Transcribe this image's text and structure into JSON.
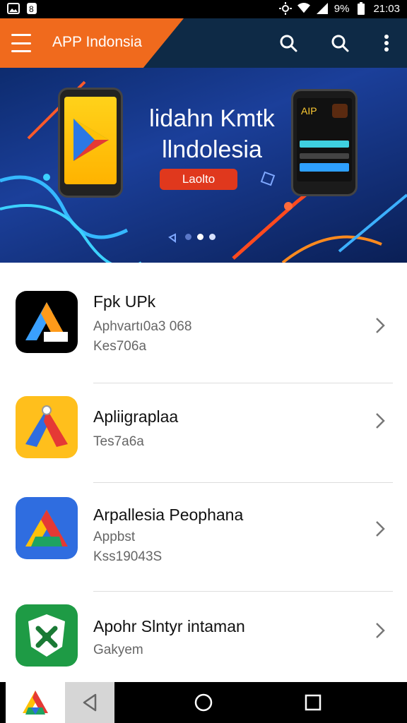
{
  "status_bar": {
    "battery": "9%",
    "time": "21:03"
  },
  "app_bar": {
    "title": "APP Indonsia"
  },
  "banner": {
    "headline_line1": "lidahn Kmtk",
    "headline_line2": "llndolesia",
    "cta_label": "Laolto",
    "phone_screen_text": "AIP"
  },
  "apps": [
    {
      "name": "Fpk UPk",
      "line1": "Aphvartı0a3 068",
      "line2": "Kes706a"
    },
    {
      "name": "Apliigraplaa",
      "line1": "Tes7a6a",
      "line2": ""
    },
    {
      "name": "Arpallesia Peophana",
      "line1": "Appbst",
      "line2": "Kss19043S"
    },
    {
      "name": "Apohr Slntyr intaman",
      "line1": "Gakyem",
      "line2": ""
    }
  ],
  "colors": {
    "accent": "#f06a1d",
    "appbar": "#0e2a46",
    "cta": "#e0381d"
  }
}
